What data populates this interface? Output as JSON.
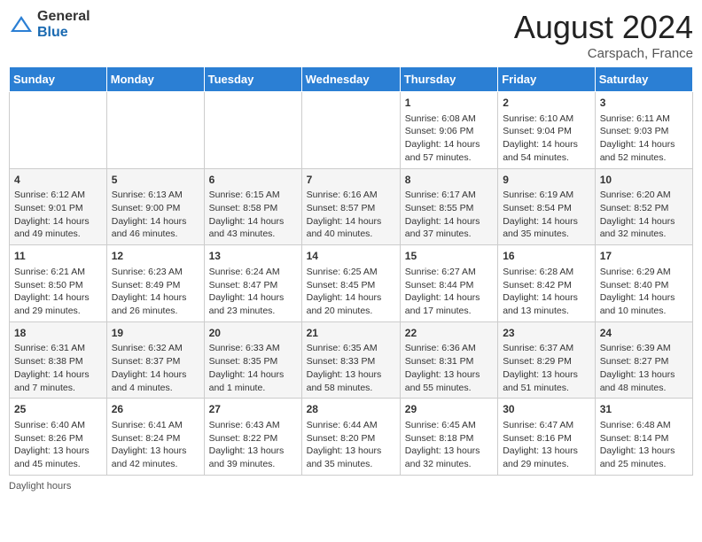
{
  "header": {
    "month_year": "August 2024",
    "location": "Carspach, France",
    "logo_general": "General",
    "logo_blue": "Blue"
  },
  "days_of_week": [
    "Sunday",
    "Monday",
    "Tuesday",
    "Wednesday",
    "Thursday",
    "Friday",
    "Saturday"
  ],
  "footer": {
    "daylight_label": "Daylight hours"
  },
  "weeks": [
    [
      {
        "day": "",
        "content": ""
      },
      {
        "day": "",
        "content": ""
      },
      {
        "day": "",
        "content": ""
      },
      {
        "day": "",
        "content": ""
      },
      {
        "day": "1",
        "content": "Sunrise: 6:08 AM\nSunset: 9:06 PM\nDaylight: 14 hours and 57 minutes."
      },
      {
        "day": "2",
        "content": "Sunrise: 6:10 AM\nSunset: 9:04 PM\nDaylight: 14 hours and 54 minutes."
      },
      {
        "day": "3",
        "content": "Sunrise: 6:11 AM\nSunset: 9:03 PM\nDaylight: 14 hours and 52 minutes."
      }
    ],
    [
      {
        "day": "4",
        "content": "Sunrise: 6:12 AM\nSunset: 9:01 PM\nDaylight: 14 hours and 49 minutes."
      },
      {
        "day": "5",
        "content": "Sunrise: 6:13 AM\nSunset: 9:00 PM\nDaylight: 14 hours and 46 minutes."
      },
      {
        "day": "6",
        "content": "Sunrise: 6:15 AM\nSunset: 8:58 PM\nDaylight: 14 hours and 43 minutes."
      },
      {
        "day": "7",
        "content": "Sunrise: 6:16 AM\nSunset: 8:57 PM\nDaylight: 14 hours and 40 minutes."
      },
      {
        "day": "8",
        "content": "Sunrise: 6:17 AM\nSunset: 8:55 PM\nDaylight: 14 hours and 37 minutes."
      },
      {
        "day": "9",
        "content": "Sunrise: 6:19 AM\nSunset: 8:54 PM\nDaylight: 14 hours and 35 minutes."
      },
      {
        "day": "10",
        "content": "Sunrise: 6:20 AM\nSunset: 8:52 PM\nDaylight: 14 hours and 32 minutes."
      }
    ],
    [
      {
        "day": "11",
        "content": "Sunrise: 6:21 AM\nSunset: 8:50 PM\nDaylight: 14 hours and 29 minutes."
      },
      {
        "day": "12",
        "content": "Sunrise: 6:23 AM\nSunset: 8:49 PM\nDaylight: 14 hours and 26 minutes."
      },
      {
        "day": "13",
        "content": "Sunrise: 6:24 AM\nSunset: 8:47 PM\nDaylight: 14 hours and 23 minutes."
      },
      {
        "day": "14",
        "content": "Sunrise: 6:25 AM\nSunset: 8:45 PM\nDaylight: 14 hours and 20 minutes."
      },
      {
        "day": "15",
        "content": "Sunrise: 6:27 AM\nSunset: 8:44 PM\nDaylight: 14 hours and 17 minutes."
      },
      {
        "day": "16",
        "content": "Sunrise: 6:28 AM\nSunset: 8:42 PM\nDaylight: 14 hours and 13 minutes."
      },
      {
        "day": "17",
        "content": "Sunrise: 6:29 AM\nSunset: 8:40 PM\nDaylight: 14 hours and 10 minutes."
      }
    ],
    [
      {
        "day": "18",
        "content": "Sunrise: 6:31 AM\nSunset: 8:38 PM\nDaylight: 14 hours and 7 minutes."
      },
      {
        "day": "19",
        "content": "Sunrise: 6:32 AM\nSunset: 8:37 PM\nDaylight: 14 hours and 4 minutes."
      },
      {
        "day": "20",
        "content": "Sunrise: 6:33 AM\nSunset: 8:35 PM\nDaylight: 14 hours and 1 minute."
      },
      {
        "day": "21",
        "content": "Sunrise: 6:35 AM\nSunset: 8:33 PM\nDaylight: 13 hours and 58 minutes."
      },
      {
        "day": "22",
        "content": "Sunrise: 6:36 AM\nSunset: 8:31 PM\nDaylight: 13 hours and 55 minutes."
      },
      {
        "day": "23",
        "content": "Sunrise: 6:37 AM\nSunset: 8:29 PM\nDaylight: 13 hours and 51 minutes."
      },
      {
        "day": "24",
        "content": "Sunrise: 6:39 AM\nSunset: 8:27 PM\nDaylight: 13 hours and 48 minutes."
      }
    ],
    [
      {
        "day": "25",
        "content": "Sunrise: 6:40 AM\nSunset: 8:26 PM\nDaylight: 13 hours and 45 minutes."
      },
      {
        "day": "26",
        "content": "Sunrise: 6:41 AM\nSunset: 8:24 PM\nDaylight: 13 hours and 42 minutes."
      },
      {
        "day": "27",
        "content": "Sunrise: 6:43 AM\nSunset: 8:22 PM\nDaylight: 13 hours and 39 minutes."
      },
      {
        "day": "28",
        "content": "Sunrise: 6:44 AM\nSunset: 8:20 PM\nDaylight: 13 hours and 35 minutes."
      },
      {
        "day": "29",
        "content": "Sunrise: 6:45 AM\nSunset: 8:18 PM\nDaylight: 13 hours and 32 minutes."
      },
      {
        "day": "30",
        "content": "Sunrise: 6:47 AM\nSunset: 8:16 PM\nDaylight: 13 hours and 29 minutes."
      },
      {
        "day": "31",
        "content": "Sunrise: 6:48 AM\nSunset: 8:14 PM\nDaylight: 13 hours and 25 minutes."
      }
    ]
  ]
}
